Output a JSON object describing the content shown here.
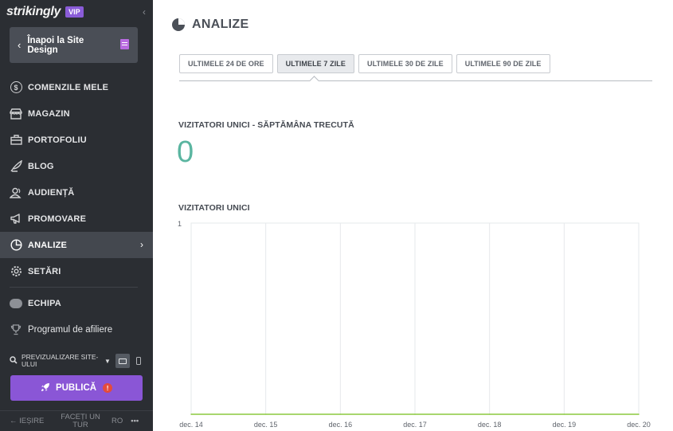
{
  "sidebar": {
    "logo": "strikingly",
    "badge": "VIP",
    "back_label": "Înapoi la Site Design",
    "items": [
      {
        "label": "COMENZILE MELE",
        "icon": "dollar-icon"
      },
      {
        "label": "MAGAZIN",
        "icon": "store-icon"
      },
      {
        "label": "PORTOFOLIU",
        "icon": "briefcase-icon"
      },
      {
        "label": "BLOG",
        "icon": "quill-icon"
      },
      {
        "label": "AUDIENȚĂ",
        "icon": "audience-icon"
      },
      {
        "label": "PROMOVARE",
        "icon": "megaphone-icon"
      },
      {
        "label": "ANALIZE",
        "icon": "pie-chart-icon",
        "active": true
      },
      {
        "label": "SETĂRI",
        "icon": "gear-icon"
      }
    ],
    "team_label": "ECHIPA",
    "affiliate_label": "Programul de afiliere",
    "preview_label": "PREVIZUALIZARE SITE-ULUI",
    "publish_label": "PUBLICĂ",
    "publish_warning": "!",
    "bottom": {
      "exit": "← IEȘIRE",
      "tour": "FACEȚI UN TUR",
      "lang": "RO",
      "more": "•••"
    }
  },
  "main": {
    "title": "ANALIZE",
    "tabs": [
      {
        "label": "ULTIMELE 24 DE ORE"
      },
      {
        "label": "ULTIMELE 7 ZILE",
        "active": true
      },
      {
        "label": "ULTIMELE 30 DE ZILE"
      },
      {
        "label": "ULTIMELE 90 DE ZILE"
      }
    ],
    "unique_week_label": "VIZITATORI UNICI - SĂPTĂMÂNA TRECUTĂ",
    "unique_week_value": "0",
    "unique_chart_label": "VIZITATORI UNICI"
  },
  "chart_data": {
    "type": "line",
    "title": "VIZITATORI UNICI",
    "x": [
      "dec. 14",
      "dec. 15",
      "dec. 16",
      "dec. 17",
      "dec. 18",
      "dec. 19",
      "dec. 20"
    ],
    "series": [
      {
        "values": [
          0,
          0,
          0,
          0,
          0,
          0,
          0
        ]
      }
    ],
    "ylim": [
      0,
      1
    ],
    "y_ticks": [
      "1"
    ],
    "grid": true,
    "line_color": "#9bd05a"
  }
}
